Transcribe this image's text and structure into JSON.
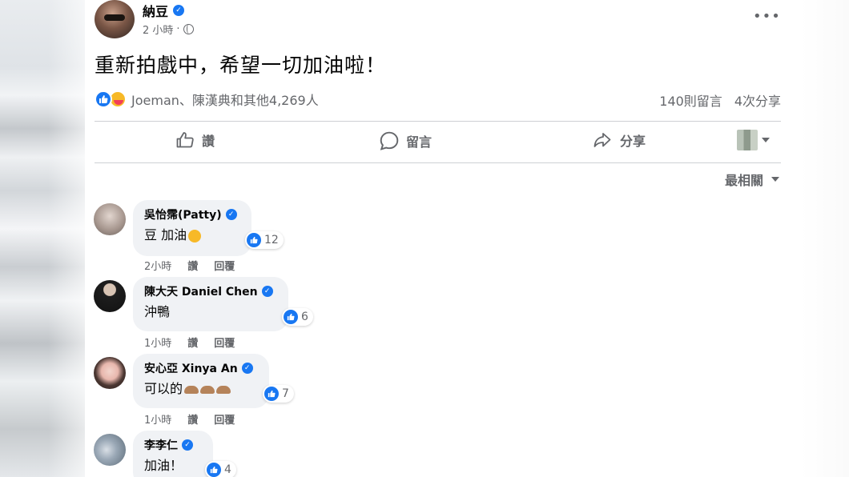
{
  "post": {
    "author": "納豆",
    "time": "2 小時",
    "dot": "·",
    "text": "重新拍戲中，希望一切加油啦！",
    "reactions_text": "Joeman、陳漢典和其他4,269人",
    "comments_count": "140則留言",
    "shares_count": "4次分享",
    "more_label": "•••"
  },
  "actions": {
    "like": "讚",
    "comment": "留言",
    "share": "分享"
  },
  "sort_label": "最相關",
  "comments": [
    {
      "name": "吳怡霈(Patty)",
      "text": "豆 加油",
      "likes": "12",
      "time": "2小時",
      "like": "讚",
      "reply": "回覆"
    },
    {
      "name": "陳大天 Daniel Chen",
      "text": "沖鴨",
      "likes": "6",
      "time": "1小時",
      "like": "讚",
      "reply": "回覆"
    },
    {
      "name": "安心亞 Xinya An",
      "text": "可以的",
      "likes": "7",
      "time": "1小時",
      "like": "讚",
      "reply": "回覆"
    },
    {
      "name": "李李仁",
      "text": "加油！",
      "likes": "4"
    }
  ],
  "colors": {
    "accent": "#1877f2",
    "muted": "#65676b",
    "bubble": "#f0f2f5"
  },
  "icons": [
    "verified-icon",
    "globe-icon",
    "more-icon",
    "like-icon",
    "comment-icon",
    "share-icon",
    "caret-down-icon"
  ]
}
